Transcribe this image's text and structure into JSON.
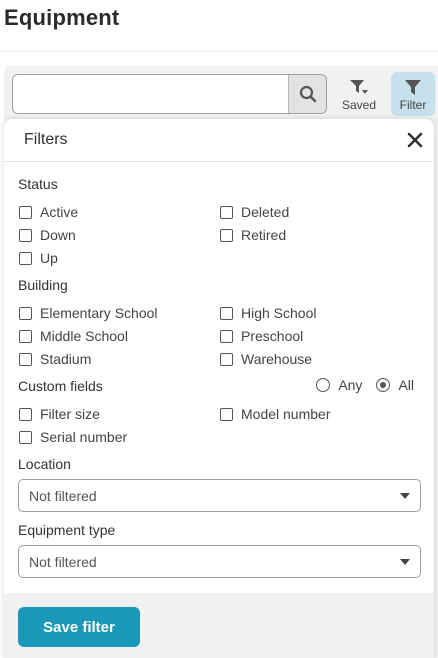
{
  "page": {
    "title": "Equipment"
  },
  "toolbar": {
    "search_placeholder": "",
    "saved_label": "Saved",
    "filter_label": "Filter"
  },
  "filters": {
    "title": "Filters",
    "status": {
      "label": "Status",
      "options": [
        {
          "label": "Active",
          "checked": false
        },
        {
          "label": "Deleted",
          "checked": false
        },
        {
          "label": "Down",
          "checked": false
        },
        {
          "label": "Retired",
          "checked": false
        },
        {
          "label": "Up",
          "checked": false
        }
      ]
    },
    "building": {
      "label": "Building",
      "options": [
        {
          "label": "Elementary School",
          "checked": false
        },
        {
          "label": "High School",
          "checked": false
        },
        {
          "label": "Middle School",
          "checked": false
        },
        {
          "label": "Preschool",
          "checked": false
        },
        {
          "label": "Stadium",
          "checked": false
        },
        {
          "label": "Warehouse",
          "checked": false
        }
      ]
    },
    "custom_fields": {
      "label": "Custom fields",
      "match": {
        "any_label": "Any",
        "all_label": "All",
        "selected": "All"
      },
      "options": [
        {
          "label": "Filter size",
          "checked": false
        },
        {
          "label": "Model number",
          "checked": false
        },
        {
          "label": "Serial number",
          "checked": false
        }
      ]
    },
    "location": {
      "label": "Location",
      "value": "Not filtered"
    },
    "equipment_type": {
      "label": "Equipment type",
      "value": "Not filtered"
    },
    "save_label": "Save filter"
  }
}
